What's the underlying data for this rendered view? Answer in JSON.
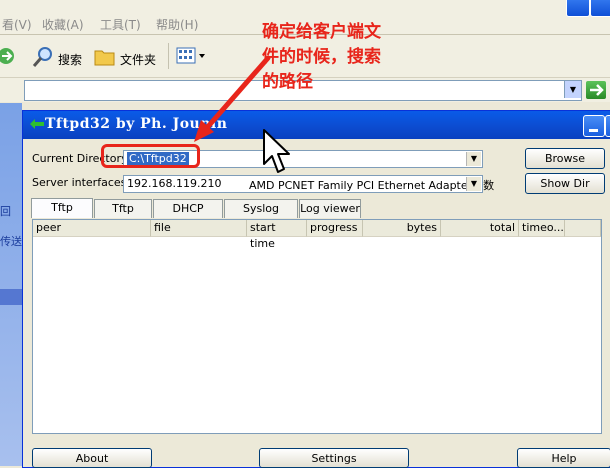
{
  "explorer": {
    "menu": [
      "看(V)",
      "收藏(A)",
      "工具(T)",
      "帮助(H)"
    ],
    "toolbar": {
      "search_label": "搜索",
      "folders_label": "文件夹"
    },
    "left_pane": {
      "link1": "回",
      "link2": "传送"
    }
  },
  "tftpd": {
    "title": "Tftpd32 by Ph. Jounin",
    "current_directory_label": "Current Directory",
    "current_directory_value": "C:\\Tftpd32",
    "server_interfaces_label": "Server interfaces",
    "server_ip": "192.168.119.210",
    "adapter": "AMD PCNET Family PCI Ethernet Adapter - 数",
    "browse_label": "Browse",
    "showdir_label": "Show Dir",
    "tabs": [
      "Tftp Server",
      "Tftp Client",
      "DHCP server",
      "Syslog server",
      "Log viewer"
    ],
    "columns": [
      "peer",
      "file",
      "start time",
      "progress",
      "bytes",
      "total",
      "timeo..."
    ],
    "buttons": {
      "about": "About",
      "settings": "Settings",
      "help": "Help"
    }
  },
  "annotation": {
    "line1": "确定给客户端文",
    "line2": "件的时候，搜索",
    "line3": "的路径"
  },
  "colors": {
    "annotation_red": "#e8251b",
    "titlebar_blue": "#0c4bcf",
    "selection_blue": "#316ac5"
  }
}
